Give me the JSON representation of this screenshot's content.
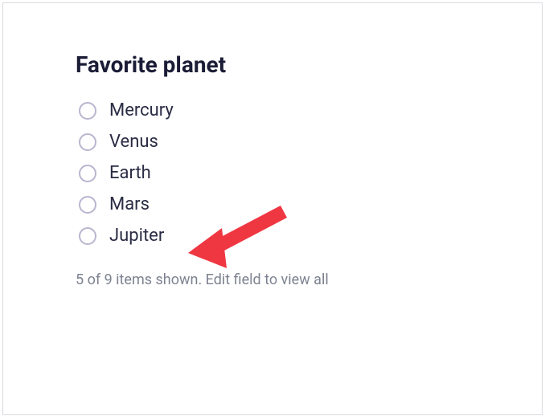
{
  "title": "Favorite planet",
  "options": [
    {
      "label": "Mercury"
    },
    {
      "label": "Venus"
    },
    {
      "label": "Earth"
    },
    {
      "label": "Mars"
    },
    {
      "label": "Jupiter"
    }
  ],
  "footer": "5 of 9 items shown. Edit field to view all",
  "colors": {
    "arrow": "#ef3742"
  }
}
